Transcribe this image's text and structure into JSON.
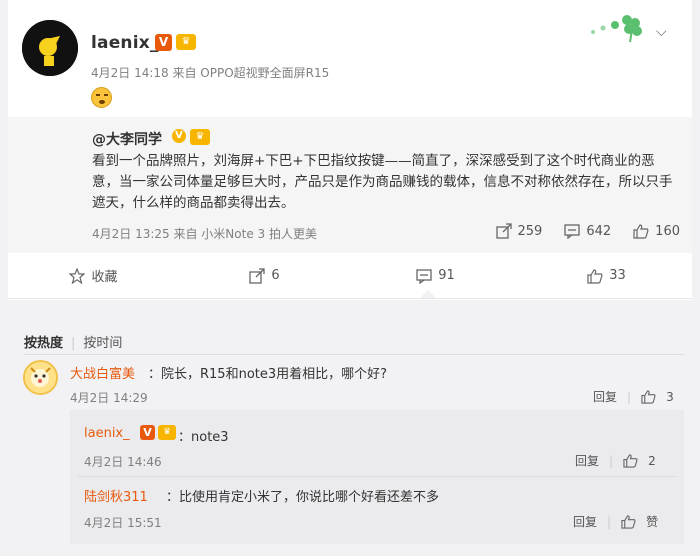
{
  "post": {
    "username": "laenix_",
    "badge_v": "V",
    "badge_vip": "♛",
    "meta": "4月2日 14:18 来自 OPPO超视野全面屏R15",
    "emoji_icon": "laughing-face-icon",
    "menu_icon": "chevron-down-icon"
  },
  "repost": {
    "user": "@大李同学",
    "badge": "V",
    "text": "看到一个品牌照片，刘海屏+下巴+下巴指纹按键——简直了，深深感受到了这个时代商业的恶意，当一家公司体量足够巨大时，产品只是作为商品赚钱的载体，信息不对称依然存在，所以只手遮天，什么样的商品都卖得出去。",
    "meta": "4月2日 13:25 来自 小米Note 3 拍人更美",
    "reposts": "259",
    "comments": "642",
    "likes": "160"
  },
  "actions": {
    "favorite": "收藏",
    "repost": "6",
    "comment": "91",
    "like": "33"
  },
  "comments": {
    "sort_hot": "按热度",
    "sort_time": "按时间",
    "items": [
      {
        "user": "大战白富美",
        "text": "：院长，R15和note3用着相比，哪个好?",
        "meta": "4月2日 14:29",
        "reply": "回复",
        "likes": "3"
      }
    ],
    "subs": [
      {
        "user": "laenix_",
        "badge_v": "V",
        "text": "：note3",
        "meta": "4月2日 14:46",
        "reply": "回复",
        "likes": "2"
      },
      {
        "user": "陆剑秋311",
        "text": "：比使用肯定小米了，你说比哪个好看还差不多",
        "meta": "4月2日 15:51",
        "reply": "回复",
        "likes": "赞"
      }
    ]
  },
  "colors": {
    "accent": "#e8590c",
    "vip": "#f7b500",
    "clover": "#5ac06f"
  }
}
